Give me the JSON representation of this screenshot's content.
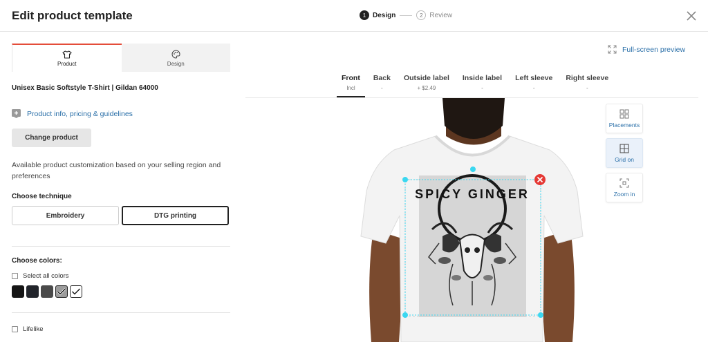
{
  "header": {
    "title": "Edit product template",
    "steps": [
      {
        "num": "1",
        "label": "Design"
      },
      {
        "num": "2",
        "label": "Review"
      }
    ]
  },
  "left": {
    "tabs": [
      {
        "label": "Product"
      },
      {
        "label": "Design"
      }
    ],
    "product_name": "Unisex Basic Softstyle T-Shirt | Gildan 64000",
    "info_link": "Product info, pricing & guidelines",
    "change_button": "Change product",
    "customization_text": "Available product customization based on your selling region and preferences",
    "technique": {
      "title": "Choose technique",
      "options": [
        "Embroidery",
        "DTG printing"
      ],
      "selected": "DTG printing"
    },
    "colors": {
      "title": "Choose colors:",
      "select_all": "Select all colors",
      "swatches": [
        {
          "color": "#151515",
          "selected": false
        },
        {
          "color": "#22252b",
          "selected": false
        },
        {
          "color": "#4a4a4a",
          "selected": false
        },
        {
          "color": "#9b9b9b",
          "selected": true
        },
        {
          "color": "#ffffff",
          "selected": true
        }
      ]
    },
    "lifelike": "Lifelike"
  },
  "main": {
    "fullscreen": "Full-screen preview",
    "placement_tabs": [
      {
        "label": "Front",
        "sub": "Incl"
      },
      {
        "label": "Back",
        "sub": "-"
      },
      {
        "label": "Outside label",
        "sub": "+ $2.49"
      },
      {
        "label": "Inside label",
        "sub": "-"
      },
      {
        "label": "Left sleeve",
        "sub": "-"
      },
      {
        "label": "Right sleeve",
        "sub": "-"
      }
    ],
    "design_text": "SPICY GINGER",
    "tools": [
      {
        "label": "Placements",
        "icon": "placements-icon"
      },
      {
        "label": "Grid on",
        "icon": "grid-icon"
      },
      {
        "label": "Zoom in",
        "icon": "zoom-in-icon"
      }
    ]
  },
  "colors": {
    "accent": "#e44d3a",
    "link": "#2a6fa8",
    "handle": "#3ad7f0",
    "delete": "#e53935"
  }
}
